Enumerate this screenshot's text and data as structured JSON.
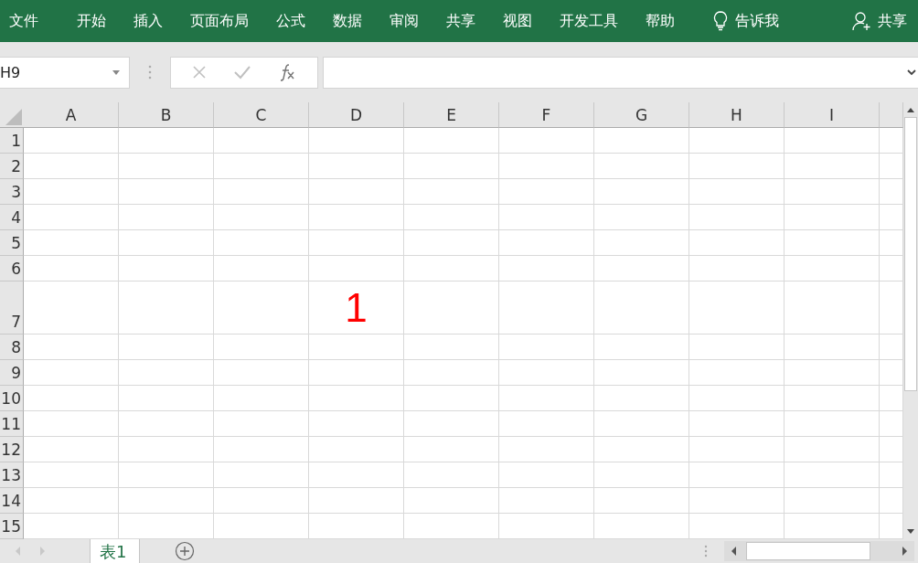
{
  "ribbon": {
    "tabs": [
      {
        "label": "文件",
        "selected": false
      },
      {
        "label": "开始",
        "selected": false
      },
      {
        "label": "插入",
        "selected": false
      },
      {
        "label": "页面布局",
        "selected": false
      },
      {
        "label": "公式",
        "selected": false
      },
      {
        "label": "数据",
        "selected": false
      },
      {
        "label": "审阅",
        "selected": false
      },
      {
        "label": "共享",
        "selected": false
      },
      {
        "label": "视图",
        "selected": false
      },
      {
        "label": "开发工具",
        "selected": false
      },
      {
        "label": "帮助",
        "selected": false
      }
    ],
    "tell_me": "告诉我",
    "share": "共享"
  },
  "formula_bar": {
    "name_box": "H9"
  },
  "sheet": {
    "columns": [
      "A",
      "B",
      "C",
      "D",
      "E",
      "F",
      "G",
      "H",
      "I"
    ],
    "rows": [
      {
        "label": "1",
        "cells": []
      },
      {
        "label": "2",
        "cells": []
      },
      {
        "label": "3",
        "cells": []
      },
      {
        "label": "4",
        "cells": []
      },
      {
        "label": "5",
        "cells": []
      },
      {
        "label": "6",
        "cells": []
      },
      {
        "label": "7",
        "kind": "large",
        "cells": [
          "",
          "",
          "",
          "1",
          "",
          "",
          "",
          "",
          ""
        ]
      },
      {
        "label": "8",
        "cells": []
      },
      {
        "label": "9",
        "cells": []
      },
      {
        "label": "10",
        "cells": []
      },
      {
        "label": "11",
        "cells": []
      },
      {
        "label": "12",
        "cells": []
      },
      {
        "label": "13",
        "cells": []
      },
      {
        "label": "14",
        "cells": []
      },
      {
        "label": "15",
        "cells": []
      }
    ]
  },
  "sheet_tabs": [
    {
      "label": "表1",
      "selected": true
    }
  ]
}
